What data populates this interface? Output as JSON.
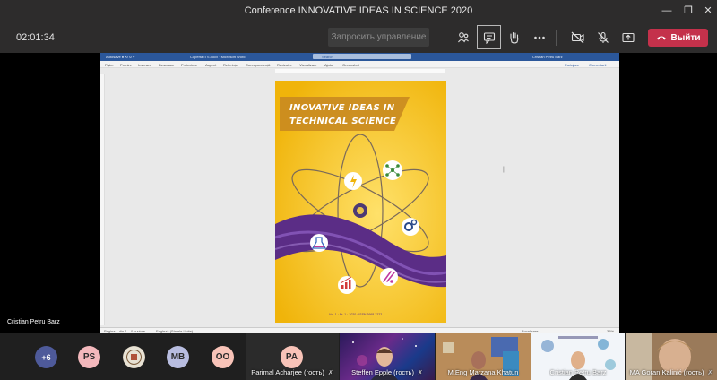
{
  "window": {
    "title": "Conference INNOVATIVE IDEAS IN SCIENCE 2020",
    "controls": [
      "minimize",
      "maximize",
      "close"
    ]
  },
  "toolbar": {
    "timer": "02:01:34",
    "request_control_label": "Запросить управление",
    "icons": [
      "participants-icon",
      "chat-icon",
      "raise-hand-icon",
      "more-icon",
      "camera-off-icon",
      "mic-off-icon",
      "share-icon"
    ],
    "leave_label": "Выйти"
  },
  "shared_screen": {
    "word_title_left": "Autosave ●  ⟲  ↻  ▾",
    "word_title_doc": "Coperta ITS.docx · Microsoft Word",
    "word_search_placeholder": "Search",
    "word_user": "Cristian Petru Barz",
    "ribbon_tabs": [
      "Fișier",
      "Pornire",
      "Inserare",
      "Desenare",
      "Proiectare",
      "Aspect",
      "Referințe",
      "Corespondență",
      "Revizuire",
      "Vizualizare",
      "Ajutor",
      "Greenshot"
    ],
    "ribbon_right": [
      "Partajare",
      "Comentarii"
    ],
    "status_left": "Pagina 1 din 1",
    "status_words": "0 cuvinte",
    "status_lang": "Engleză (Statele Unite)",
    "status_focus": "Focalizare",
    "status_zoom": "35%",
    "cover": {
      "title_line1": "INOVATIVE IDEAS IN",
      "title_line2": "TECHNICAL SCIENCE",
      "footer": "Vol. 1 · Nr. 1 · 2020 · ISSN 2668-2222",
      "colors": {
        "background": "#f3c418",
        "wave": "#5b2d86",
        "banner": "#c98a20",
        "title": "#ffffff"
      }
    }
  },
  "presenter_name": "Cristian Petru Barz",
  "participants": {
    "overflow": "+6",
    "avatars": [
      {
        "initials": "PS",
        "color": "#f3b8bc"
      },
      {
        "initials": "",
        "color": "#d9d0c0"
      },
      {
        "initials": "MB",
        "color": "#b8bde0"
      },
      {
        "initials": "OO",
        "color": "#f8c3b8"
      }
    ],
    "tiles": [
      {
        "initials": "PA",
        "name": "Parimal Acharjee (гость)"
      },
      {
        "name": "Steffen Epple (гость)"
      },
      {
        "name": "M.Eng Marzana Khatun"
      },
      {
        "name": "Cristian Petru Barz"
      },
      {
        "name": "MA Goran Kalinić (гость)"
      }
    ]
  }
}
